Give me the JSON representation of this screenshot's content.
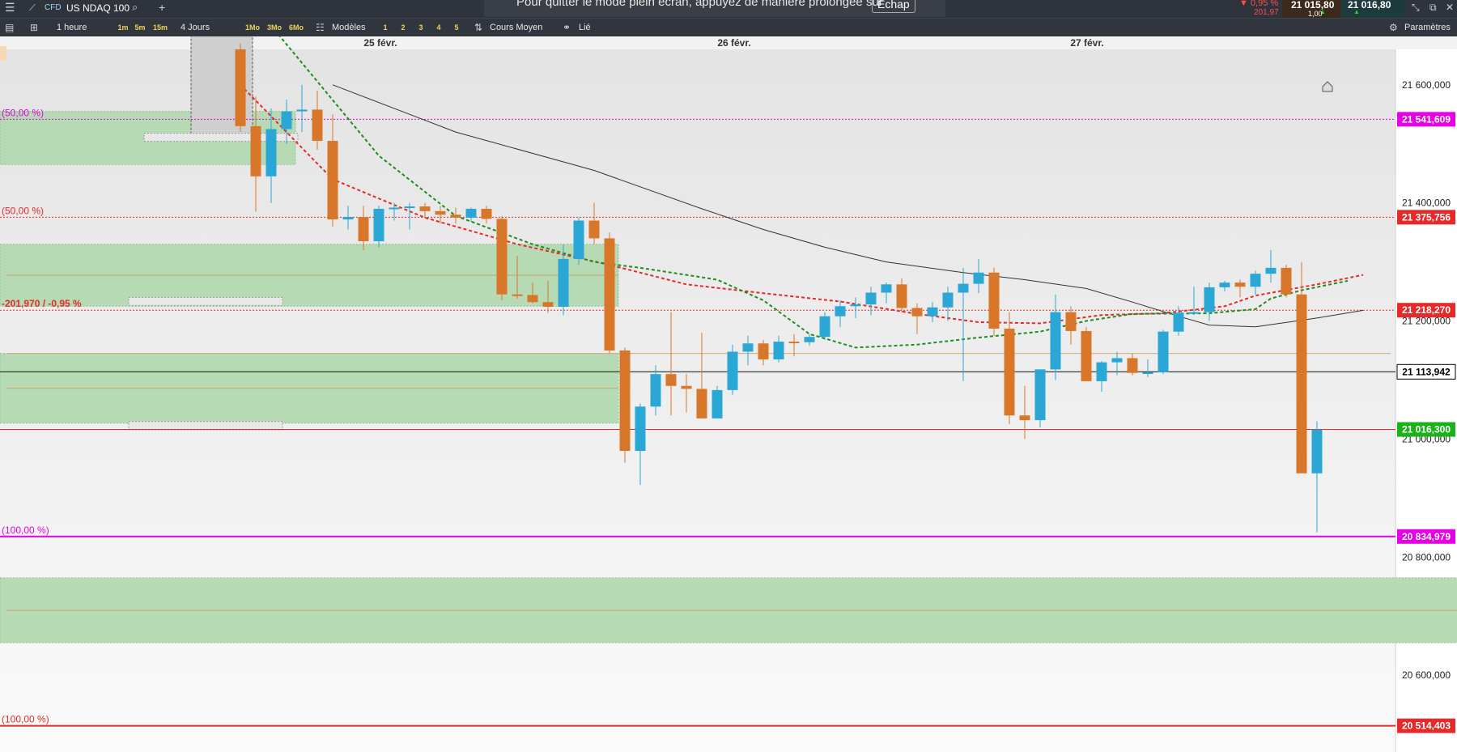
{
  "topbar": {
    "menu_icon": "hamburger-icon",
    "instrument_tag": "CFD",
    "instrument_name": "US NDAQ 100",
    "search_icon": "search-icon",
    "add_icon": "plus-icon",
    "fullscreen_notice": "Pour quitter le mode plein écran, appuyez de manière prolongée sur",
    "fullscreen_key": "Échap",
    "change_pct": "▼ 0,95 %",
    "change_abs": "201,97",
    "bid_price": "21 015,80",
    "spread": "1,00",
    "ask_price": "21 016,80"
  },
  "toolbar": {
    "interval": "1 heure",
    "intervals": [
      "1m",
      "5m",
      "15m"
    ],
    "range": "4 Jours",
    "ranges": [
      "1Mo",
      "3Mo",
      "6Mo"
    ],
    "models_label": "Modèles",
    "layouts": [
      "1",
      "2",
      "3",
      "4",
      "5"
    ],
    "price_mode": "Cours Moyen",
    "link_label": "Lié",
    "settings_label": "Paramètres"
  },
  "colors": {
    "bull": "#2aa7d4",
    "bear": "#d8772a",
    "ema_fast": "#1e8c1e",
    "ema_mid": "#e62a2a",
    "sma_slow": "#333333",
    "zone": "#b3d9b1",
    "magenta": "#e600e6",
    "red_line": "#e62a2a"
  },
  "chart_data": {
    "type": "candlestick",
    "instrument": "US NDAQ 100",
    "timeframe": "1 heure",
    "x_labels": [
      "25 févr.",
      "26 févr.",
      "27 févr."
    ],
    "ylim": [
      20470,
      21660
    ],
    "y_ticks": [
      "21 600,000",
      "21 400,000",
      "21 200,000",
      "21 000,000",
      "20 800,000",
      "20 600,000"
    ],
    "y_tick_values": [
      21600,
      21400,
      21200,
      21000,
      20800,
      20600
    ],
    "candles": [
      {
        "o": 21660,
        "h": 21670,
        "l": 21520,
        "c": 21530
      },
      {
        "o": 21530,
        "h": 21580,
        "l": 21385,
        "c": 21445
      },
      {
        "o": 21445,
        "h": 21560,
        "l": 21400,
        "c": 21525
      },
      {
        "o": 21525,
        "h": 21575,
        "l": 21500,
        "c": 21555
      },
      {
        "o": 21555,
        "h": 21600,
        "l": 21520,
        "c": 21558
      },
      {
        "o": 21558,
        "h": 21590,
        "l": 21490,
        "c": 21505
      },
      {
        "o": 21505,
        "h": 21550,
        "l": 21360,
        "c": 21372
      },
      {
        "o": 21372,
        "h": 21395,
        "l": 21355,
        "c": 21376
      },
      {
        "o": 21376,
        "h": 21395,
        "l": 21320,
        "c": 21335
      },
      {
        "o": 21335,
        "h": 21395,
        "l": 21325,
        "c": 21390
      },
      {
        "o": 21390,
        "h": 21400,
        "l": 21370,
        "c": 21392
      },
      {
        "o": 21392,
        "h": 21400,
        "l": 21355,
        "c": 21394
      },
      {
        "o": 21394,
        "h": 21400,
        "l": 21375,
        "c": 21386
      },
      {
        "o": 21386,
        "h": 21395,
        "l": 21365,
        "c": 21380
      },
      {
        "o": 21380,
        "h": 21392,
        "l": 21365,
        "c": 21375
      },
      {
        "o": 21375,
        "h": 21392,
        "l": 21368,
        "c": 21390
      },
      {
        "o": 21390,
        "h": 21395,
        "l": 21365,
        "c": 21373
      },
      {
        "o": 21373,
        "h": 21378,
        "l": 21235,
        "c": 21245
      },
      {
        "o": 21245,
        "h": 21310,
        "l": 21238,
        "c": 21244
      },
      {
        "o": 21244,
        "h": 21265,
        "l": 21230,
        "c": 21232
      },
      {
        "o": 21232,
        "h": 21268,
        "l": 21214,
        "c": 21224
      },
      {
        "o": 21224,
        "h": 21330,
        "l": 21210,
        "c": 21305
      },
      {
        "o": 21305,
        "h": 21375,
        "l": 21295,
        "c": 21370
      },
      {
        "o": 21370,
        "h": 21400,
        "l": 21330,
        "c": 21340
      },
      {
        "o": 21340,
        "h": 21350,
        "l": 21145,
        "c": 21150
      },
      {
        "o": 21150,
        "h": 21155,
        "l": 20960,
        "c": 20980
      },
      {
        "o": 20980,
        "h": 21060,
        "l": 20922,
        "c": 21055
      },
      {
        "o": 21055,
        "h": 21125,
        "l": 21040,
        "c": 21110
      },
      {
        "o": 21110,
        "h": 21215,
        "l": 21040,
        "c": 21090
      },
      {
        "o": 21090,
        "h": 21110,
        "l": 21045,
        "c": 21085
      },
      {
        "o": 21085,
        "h": 21180,
        "l": 21050,
        "c": 21035
      },
      {
        "o": 21035,
        "h": 21090,
        "l": 21035,
        "c": 21083
      },
      {
        "o": 21083,
        "h": 21160,
        "l": 21075,
        "c": 21148
      },
      {
        "o": 21148,
        "h": 21175,
        "l": 21125,
        "c": 21162
      },
      {
        "o": 21162,
        "h": 21168,
        "l": 21125,
        "c": 21135
      },
      {
        "o": 21135,
        "h": 21175,
        "l": 21130,
        "c": 21165
      },
      {
        "o": 21165,
        "h": 21178,
        "l": 21140,
        "c": 21164
      },
      {
        "o": 21164,
        "h": 21178,
        "l": 21158,
        "c": 21173
      },
      {
        "o": 21173,
        "h": 21215,
        "l": 21168,
        "c": 21208
      },
      {
        "o": 21208,
        "h": 21235,
        "l": 21190,
        "c": 21225
      },
      {
        "o": 21225,
        "h": 21240,
        "l": 21205,
        "c": 21228
      },
      {
        "o": 21228,
        "h": 21258,
        "l": 21210,
        "c": 21248
      },
      {
        "o": 21248,
        "h": 21265,
        "l": 21230,
        "c": 21262
      },
      {
        "o": 21262,
        "h": 21272,
        "l": 21215,
        "c": 21222
      },
      {
        "o": 21222,
        "h": 21230,
        "l": 21178,
        "c": 21208
      },
      {
        "o": 21208,
        "h": 21232,
        "l": 21198,
        "c": 21223
      },
      {
        "o": 21223,
        "h": 21258,
        "l": 21200,
        "c": 21248
      },
      {
        "o": 21248,
        "h": 21290,
        "l": 21098,
        "c": 21263
      },
      {
        "o": 21263,
        "h": 21305,
        "l": 21247,
        "c": 21282
      },
      {
        "o": 21282,
        "h": 21290,
        "l": 21175,
        "c": 21187
      },
      {
        "o": 21187,
        "h": 21215,
        "l": 21025,
        "c": 21040
      },
      {
        "o": 21040,
        "h": 21090,
        "l": 21000,
        "c": 21032
      },
      {
        "o": 21032,
        "h": 21115,
        "l": 21020,
        "c": 21118
      },
      {
        "o": 21118,
        "h": 21245,
        "l": 21100,
        "c": 21215
      },
      {
        "o": 21215,
        "h": 21225,
        "l": 21160,
        "c": 21183
      },
      {
        "o": 21183,
        "h": 21190,
        "l": 21100,
        "c": 21098
      },
      {
        "o": 21098,
        "h": 21132,
        "l": 21080,
        "c": 21130
      },
      {
        "o": 21130,
        "h": 21148,
        "l": 21108,
        "c": 21137
      },
      {
        "o": 21137,
        "h": 21145,
        "l": 21108,
        "c": 21112
      },
      {
        "o": 21112,
        "h": 21135,
        "l": 21105,
        "c": 21113
      },
      {
        "o": 21113,
        "h": 21185,
        "l": 21110,
        "c": 21182
      },
      {
        "o": 21182,
        "h": 21225,
        "l": 21175,
        "c": 21214
      },
      {
        "o": 21214,
        "h": 21258,
        "l": 21210,
        "c": 21215
      },
      {
        "o": 21215,
        "h": 21265,
        "l": 21200,
        "c": 21257
      },
      {
        "o": 21257,
        "h": 21268,
        "l": 21250,
        "c": 21265
      },
      {
        "o": 21265,
        "h": 21270,
        "l": 21240,
        "c": 21258
      },
      {
        "o": 21258,
        "h": 21285,
        "l": 21245,
        "c": 21280
      },
      {
        "o": 21280,
        "h": 21320,
        "l": 21265,
        "c": 21290
      },
      {
        "o": 21290,
        "h": 21295,
        "l": 21240,
        "c": 21245
      },
      {
        "o": 21245,
        "h": 21300,
        "l": 21035,
        "c": 20942
      },
      {
        "o": 20942,
        "h": 21030,
        "l": 20842,
        "c": 21016
      }
    ],
    "ema_fast": [
      [
        21700,
        18
      ],
      [
        21480,
        25
      ],
      [
        21378,
        30
      ],
      [
        21330,
        35
      ],
      [
        21300,
        39
      ],
      [
        21290,
        42
      ],
      [
        21282,
        44
      ],
      [
        21270,
        47
      ],
      [
        21235,
        50
      ],
      [
        21178,
        53
      ],
      [
        21155,
        56
      ],
      [
        21160,
        60
      ],
      [
        21172,
        64
      ],
      [
        21182,
        68
      ],
      [
        21200,
        71
      ],
      [
        21212,
        74
      ],
      [
        21213,
        79
      ],
      [
        21220,
        82
      ],
      [
        21238,
        83
      ],
      [
        21252,
        85
      ],
      [
        21268,
        88
      ]
    ],
    "ema_mid": [
      [
        21600,
        16
      ],
      [
        21440,
        22
      ],
      [
        21375,
        28
      ],
      [
        21330,
        34
      ],
      [
        21295,
        40
      ],
      [
        21262,
        45
      ],
      [
        21247,
        50
      ],
      [
        21233,
        55
      ],
      [
        21212,
        60
      ],
      [
        21198,
        64
      ],
      [
        21196,
        68
      ],
      [
        21210,
        72
      ],
      [
        21213,
        76
      ],
      [
        21225,
        80
      ],
      [
        21243,
        82
      ],
      [
        21262,
        86
      ],
      [
        21278,
        89
      ]
    ],
    "sma_slow": [
      [
        21600,
        22
      ],
      [
        21520,
        30
      ],
      [
        21455,
        39
      ],
      [
        21390,
        46
      ],
      [
        21355,
        50
      ],
      [
        21325,
        54
      ],
      [
        21300,
        58
      ],
      [
        21282,
        63
      ],
      [
        21270,
        67
      ],
      [
        21255,
        71
      ],
      [
        21232,
        74
      ],
      [
        21208,
        77
      ],
      [
        21193,
        79
      ],
      [
        21190,
        82
      ],
      [
        21205,
        86
      ],
      [
        21218,
        89
      ]
    ],
    "hlines": [
      {
        "price": 21541.609,
        "label": "21 541,609",
        "style": "dotted",
        "color": "#e600e6",
        "tag": "(50,00 %)"
      },
      {
        "price": 21375.756,
        "label": "21 375,756",
        "style": "dotted",
        "color": "#e62a2a",
        "tag": "(50,00 %)"
      },
      {
        "price": 21218.27,
        "label": "21 218,270",
        "style": "dotted",
        "color": "#e62a2a",
        "tag": "-201,970 / -0,95 %"
      },
      {
        "price": 21113.942,
        "label": "21 113,942",
        "style": "solid",
        "color": "#111111",
        "tag": ""
      },
      {
        "price": 21016.3,
        "label": "21 016,300",
        "style": "solid",
        "color": "#e62a2a",
        "tag": ""
      },
      {
        "price": 20834.979,
        "label": "20 834,979",
        "style": "solid",
        "color": "#e600e6",
        "tag": "(100,00 %)"
      },
      {
        "price": 20514.403,
        "label": "20 514,403",
        "style": "solid",
        "color": "#e62a2a",
        "tag": "(100,00 %)"
      }
    ],
    "zones": [
      {
        "from": 21555,
        "to": 21465,
        "x0": 0,
        "x1": 4
      },
      {
        "from": 21330,
        "to": 21225,
        "x0": 0,
        "x1": 25
      },
      {
        "from": 21145,
        "to": 21027,
        "x0": 0,
        "x1": 25
      },
      {
        "from": 20765,
        "to": 20655,
        "x0": 0,
        "x1": 92
      }
    ]
  }
}
